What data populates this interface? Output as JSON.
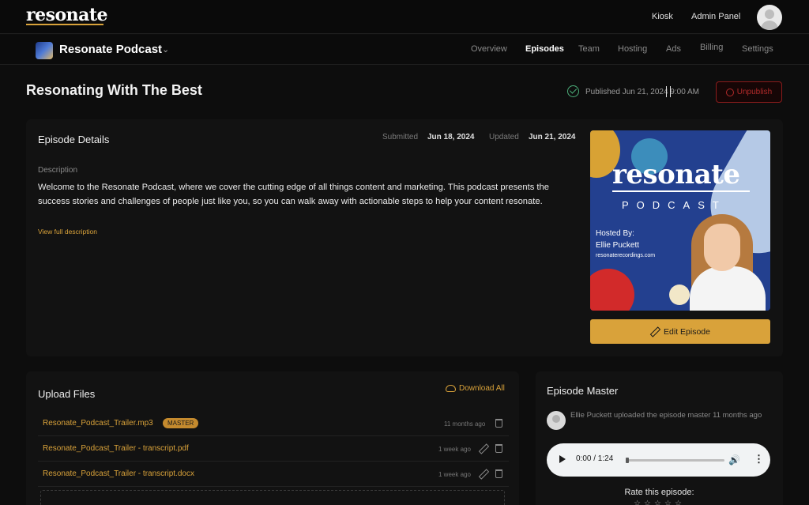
{
  "topbar": {
    "logo": "resonate",
    "links": [
      "Kiosk",
      "Admin Panel"
    ]
  },
  "subnav": {
    "podcast_name": "Resonate Podcast",
    "tabs": [
      "Overview",
      "Episodes",
      "Team",
      "Hosting",
      "Ads",
      "Billing",
      "Settings"
    ],
    "active_tab": "Episodes"
  },
  "episode": {
    "title": "Resonating With The Best",
    "published": "Published Jun 21, 2024 9:00 AM",
    "unpublish_label": "Unpublish"
  },
  "details": {
    "title": "Episode Details",
    "submitted_label": "Submitted",
    "submitted_value": "Jun 18, 2024",
    "updated_label": "Updated",
    "updated_value": "Jun 21, 2024",
    "description_label": "Description",
    "description": "Welcome to the Resonate Podcast, where we cover the cutting edge of all things content and marketing. This podcast presents the success stories and challenges of people just like you, so you can walk away with actionable steps to help your content resonate.",
    "view_full": "View full description",
    "edit_label": "Edit Episode"
  },
  "cover": {
    "logo": "resonate",
    "subtitle": "PODCAST",
    "hosted_by": "Hosted By:",
    "host": "Ellie Puckett",
    "site": "resonaterecordings.com"
  },
  "upload": {
    "title": "Upload Files",
    "download_all": "Download All",
    "files": [
      {
        "name": "Resonate_Podcast_Trailer.mp3",
        "badge": "MASTER",
        "time": "11 months ago"
      },
      {
        "name": "Resonate_Podcast_Trailer - transcript.pdf",
        "time": "1 week ago"
      },
      {
        "name": "Resonate_Podcast_Trailer - transcript.docx",
        "time": "1 week ago"
      }
    ]
  },
  "master": {
    "title": "Episode Master",
    "uploader_text": "Ellie Puckett uploaded the episode master 11 months ago",
    "player_time": "0:00 / 1:24",
    "rate_label": "Rate this episode:"
  },
  "colors": {
    "accent": "#d9a23a",
    "danger": "#b22a2a",
    "success": "#4caf7a"
  }
}
